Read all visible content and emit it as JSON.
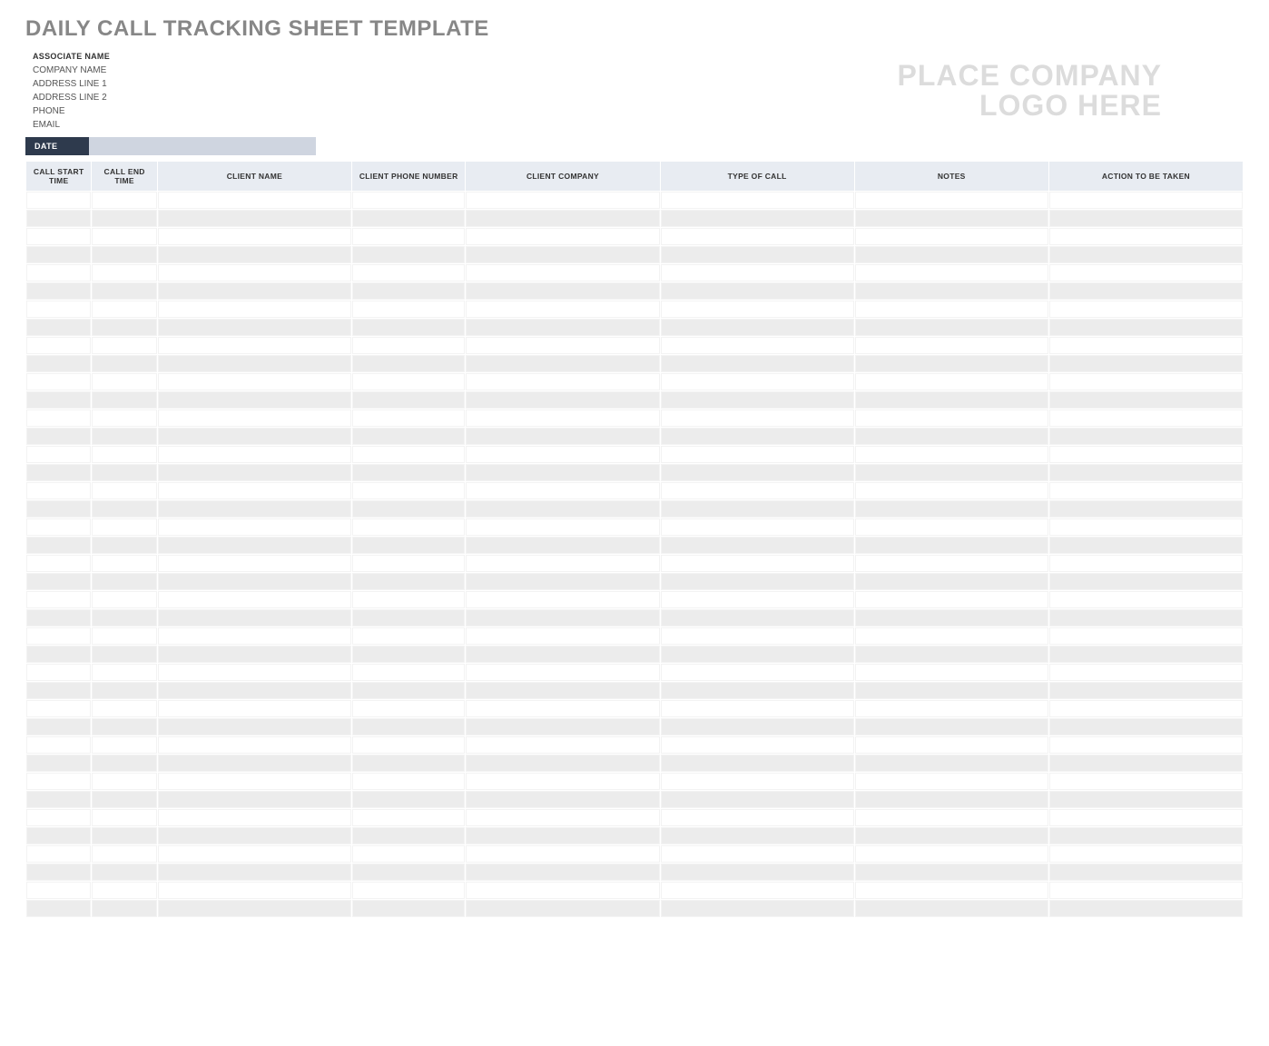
{
  "title": "DAILY CALL TRACKING SHEET TEMPLATE",
  "associate": {
    "label": "ASSOCIATE NAME",
    "company": "COMPANY NAME",
    "address1": "ADDRESS LINE 1",
    "address2": "ADDRESS LINE 2",
    "phone": "PHONE",
    "email": "EMAIL"
  },
  "logo_placeholder_line1": "PLACE COMPANY",
  "logo_placeholder_line2": "LOGO HERE",
  "date_label": "DATE",
  "date_value": "",
  "columns": [
    "CALL START TIME",
    "CALL END TIME",
    "CLIENT NAME",
    "CLIENT PHONE NUMBER",
    "CLIENT COMPANY",
    "TYPE OF CALL",
    "NOTES",
    "ACTION TO BE TAKEN"
  ],
  "row_count": 40
}
